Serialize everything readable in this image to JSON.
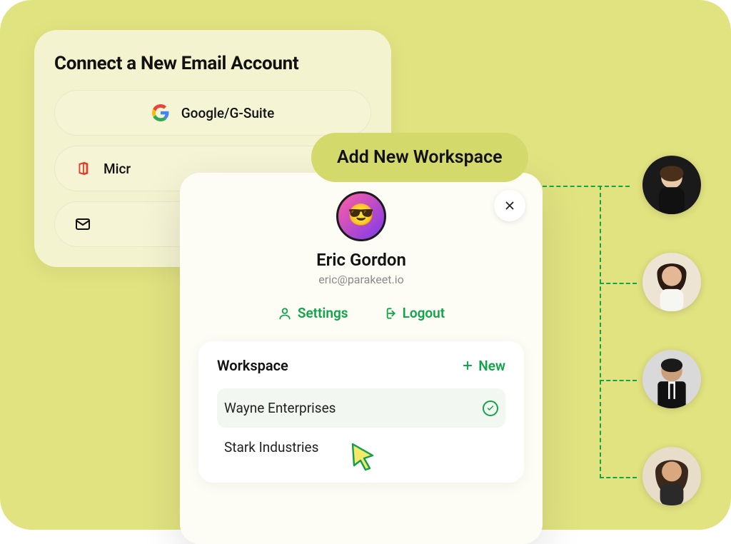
{
  "connect": {
    "title": "Connect a New Email Account",
    "options": [
      {
        "icon": "google",
        "label": "Google/G-Suite"
      },
      {
        "icon": "office",
        "label": "Micr"
      },
      {
        "icon": "imap",
        "label": ""
      }
    ]
  },
  "add_workspace_pill": "Add New Workspace",
  "profile": {
    "name": "Eric Gordon",
    "email": "eric@parakeet.io",
    "settings_label": "Settings",
    "logout_label": "Logout"
  },
  "workspace": {
    "title": "Workspace",
    "new_label": "New",
    "items": [
      {
        "name": "Wayne Enterprises",
        "selected": true
      },
      {
        "name": "Stark Industries",
        "selected": false
      }
    ]
  },
  "colors": {
    "accent_green": "#11a54a",
    "canvas_yellow": "#e1e381",
    "pill_yellow": "#d4d96c"
  }
}
